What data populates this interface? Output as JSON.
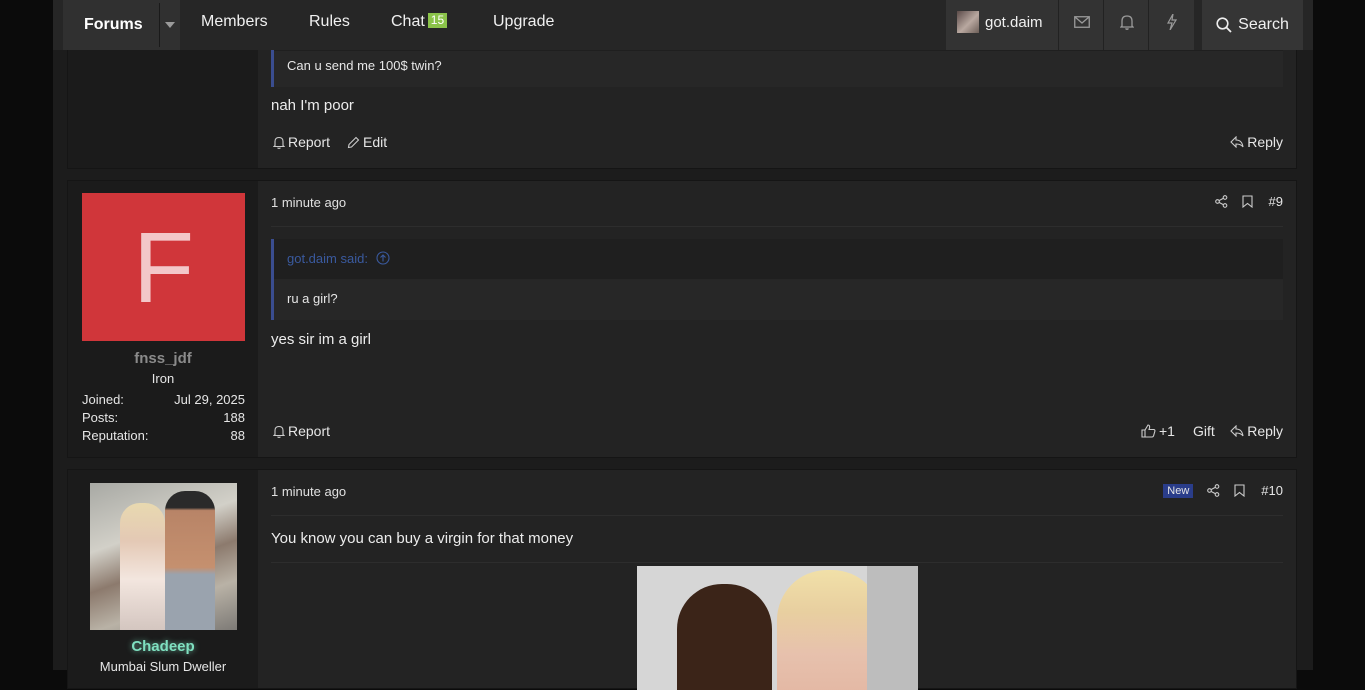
{
  "nav": {
    "forums": "Forums",
    "members": "Members",
    "rules": "Rules",
    "chat": "Chat",
    "chat_count": "15",
    "upgrade": "Upgrade",
    "username": "got.daim",
    "search": "Search"
  },
  "post_top": {
    "quote_text": "Can u send me 100$ twin?",
    "message": "nah I'm poor",
    "report": "Report",
    "edit": "Edit",
    "reply": "Reply"
  },
  "post9": {
    "avatar_letter": "F",
    "username": "fnss_jdf",
    "role": "Iron",
    "stats": [
      {
        "label": "Joined:",
        "value": "Jul 29, 2025"
      },
      {
        "label": "Posts:",
        "value": "188"
      },
      {
        "label": "Reputation:",
        "value": "88"
      }
    ],
    "time": "1 minute ago",
    "number": "#9",
    "quote_author": "got.daim said:",
    "quote_text": "ru a girl?",
    "message": "yes sir im a girl",
    "report": "Report",
    "like_count": "+1",
    "gift": "Gift",
    "reply": "Reply"
  },
  "post10": {
    "username": "Chadeep",
    "role": "Mumbai Slum Dweller",
    "time": "1 minute ago",
    "new_badge": "New",
    "number": "#10",
    "message": "You know you can buy a virgin for that money"
  },
  "colors": {
    "accent_blue": "#3a4d8f",
    "chat_badge": "#8bc34a",
    "username_green": "#7fe0c0",
    "avatar_red": "#d0363a"
  }
}
